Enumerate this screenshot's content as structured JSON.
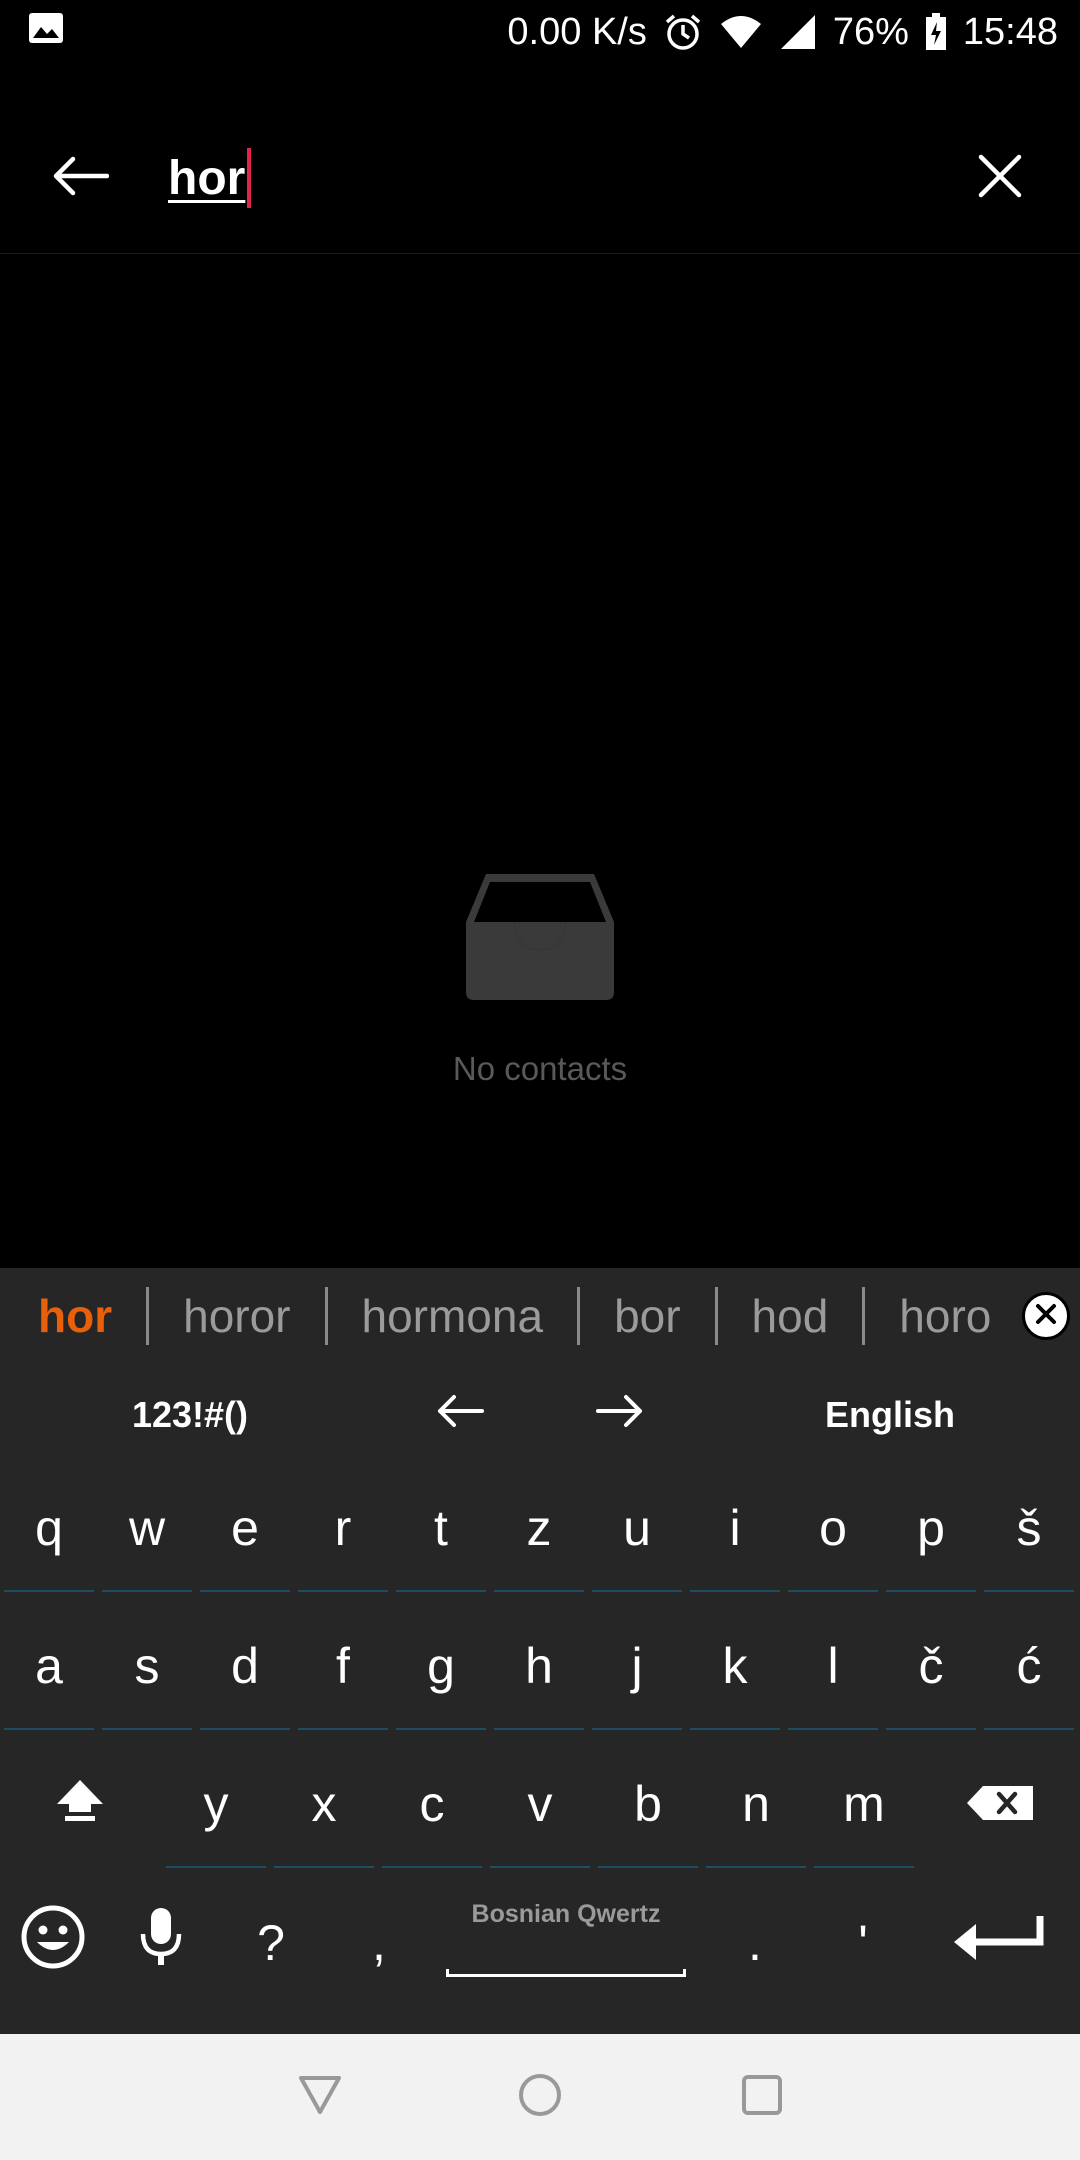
{
  "status_bar": {
    "net_speed": "0.00 K/s",
    "battery": "76%",
    "time": "15:48",
    "icons": [
      "image-icon",
      "alarm-icon",
      "wifi-icon",
      "signal-icon",
      "battery-charging-icon"
    ]
  },
  "search": {
    "value": "hor",
    "back_icon": "arrow-left-icon",
    "clear_icon": "close-icon"
  },
  "empty_state": {
    "icon": "inbox-icon",
    "text": "No contacts"
  },
  "keyboard": {
    "suggestions": [
      "hor",
      "horor",
      "hormona",
      "bor",
      "hod",
      "horo"
    ],
    "toolbar": {
      "symbols": "123!#()",
      "language": "English"
    },
    "rows": [
      [
        "q",
        "w",
        "e",
        "r",
        "t",
        "z",
        "u",
        "i",
        "o",
        "p",
        "š"
      ],
      [
        "a",
        "s",
        "d",
        "f",
        "g",
        "h",
        "j",
        "k",
        "l",
        "č",
        "ć"
      ],
      [
        "y",
        "x",
        "c",
        "v",
        "b",
        "n",
        "m"
      ]
    ],
    "bottom": {
      "question": "?",
      "comma": ",",
      "space_label": "Bosnian Qwertz",
      "period": ".",
      "apostrophe": "'"
    },
    "colors": {
      "background": "#262626",
      "accent": "#e8600a",
      "key_underline": "#1e4d63"
    }
  },
  "nav_bar": {
    "buttons": [
      "back-triangle-icon",
      "home-circle-icon",
      "recents-square-icon"
    ]
  }
}
